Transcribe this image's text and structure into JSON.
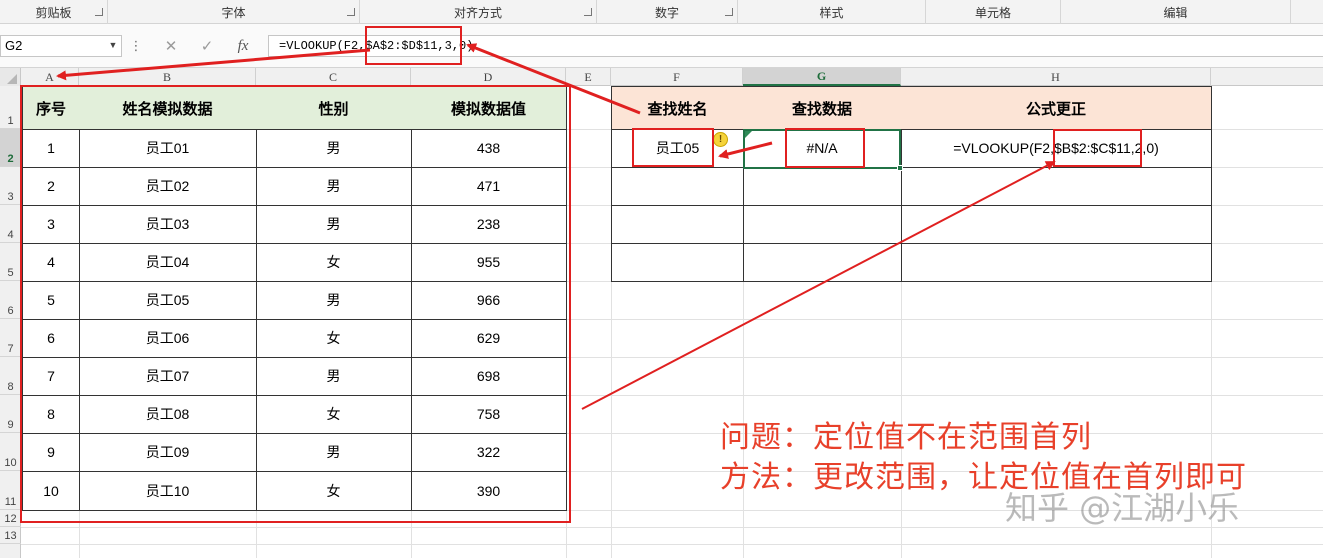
{
  "ribbon": {
    "groups": [
      "剪贴板",
      "字体",
      "对齐方式",
      "数字",
      "样式",
      "单元格",
      "编辑"
    ]
  },
  "formula_bar": {
    "name_box": "G2",
    "formula": "=VLOOKUP(F2,$A$2:$D$11,3,0)",
    "fx_label": "fx"
  },
  "grid": {
    "columns": [
      "A",
      "B",
      "C",
      "D",
      "E",
      "F",
      "G",
      "H"
    ],
    "rows": [
      "1",
      "2",
      "3",
      "4",
      "5",
      "6",
      "7",
      "8",
      "9",
      "10",
      "11",
      "12",
      "13"
    ],
    "selected_column": "G",
    "selected_row": "2"
  },
  "data_table": {
    "headers": [
      "序号",
      "姓名模拟数据",
      "性别",
      "模拟数据值"
    ],
    "rows": [
      [
        "1",
        "员工01",
        "男",
        "438"
      ],
      [
        "2",
        "员工02",
        "男",
        "471"
      ],
      [
        "3",
        "员工03",
        "男",
        "238"
      ],
      [
        "4",
        "员工04",
        "女",
        "955"
      ],
      [
        "5",
        "员工05",
        "男",
        "966"
      ],
      [
        "6",
        "员工06",
        "女",
        "629"
      ],
      [
        "7",
        "员工07",
        "男",
        "698"
      ],
      [
        "8",
        "员工08",
        "女",
        "758"
      ],
      [
        "9",
        "员工09",
        "男",
        "322"
      ],
      [
        "10",
        "员工10",
        "女",
        "390"
      ]
    ]
  },
  "lookup_table": {
    "headers": [
      "查找姓名",
      "查找数据",
      "公式更正"
    ],
    "lookup_name": "员工05",
    "result": "#N/A",
    "corrected_formula": "=VLOOKUP(F2,$B$2:$C$11,2,0)"
  },
  "annotations": {
    "problem": "问题：定位值不在范围首列",
    "method": "方法：更改范围，让定位值在首列即可"
  },
  "watermark": "知乎 @江湖小乐",
  "colors": {
    "accent_red": "#e02020",
    "excel_green": "#217346",
    "header_green": "#e2efda",
    "header_peach": "#fce4d6"
  }
}
